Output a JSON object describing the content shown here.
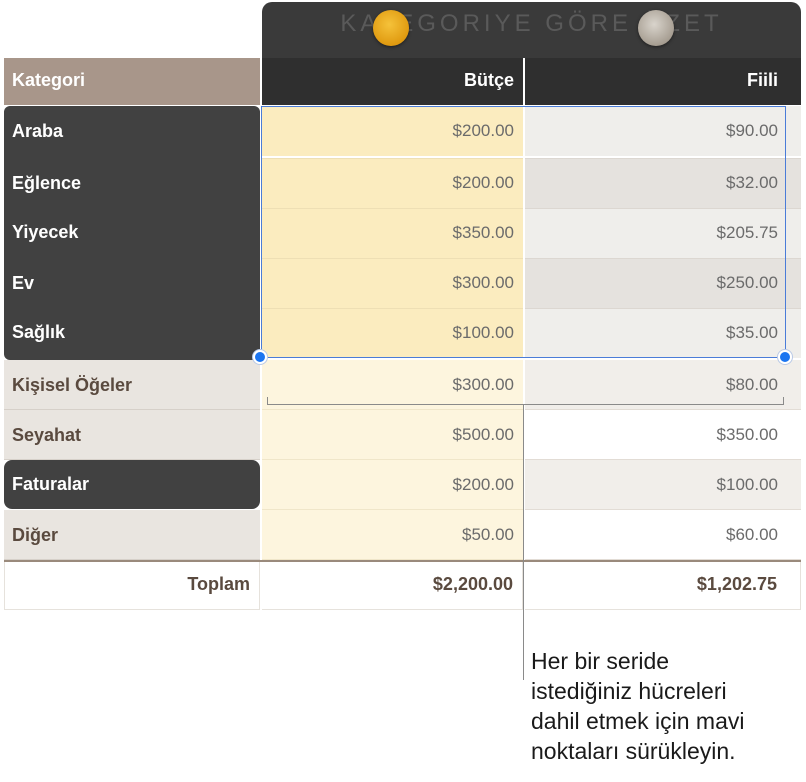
{
  "chart_title": "KATEGORIYE GÖRE ÖZET",
  "headers": {
    "category": "Kategori",
    "budget": "Bütçe",
    "actual": "Fiili"
  },
  "rows": [
    {
      "category": "Araba",
      "budget": "$200.00",
      "actual": "$90.00"
    },
    {
      "category": "Eğlence",
      "budget": "$200.00",
      "actual": "$32.00"
    },
    {
      "category": "Yiyecek",
      "budget": "$350.00",
      "actual": "$205.75"
    },
    {
      "category": "Ev",
      "budget": "$300.00",
      "actual": "$250.00"
    },
    {
      "category": "Sağlık",
      "budget": "$100.00",
      "actual": "$35.00"
    },
    {
      "category": "Kişisel Öğeler",
      "budget": "$300.00",
      "actual": "$80.00"
    },
    {
      "category": "Seyahat",
      "budget": "$500.00",
      "actual": "$350.00"
    },
    {
      "category": "Faturalar",
      "budget": "$200.00",
      "actual": "$100.00"
    },
    {
      "category": "Diğer",
      "budget": "$50.00",
      "actual": "$60.00"
    }
  ],
  "footer": {
    "label": "Toplam",
    "budget_total": "$2,200.00",
    "actual_total": "$1,202.75"
  },
  "callout": {
    "line1": "Her bir seride",
    "line2": "istediğiniz hücreleri",
    "line3": "dahil etmek için mavi",
    "line4": "noktaları sürükleyin."
  },
  "colors": {
    "selection": "#4a7cd8",
    "handle": "#1a74f0",
    "series_budget": "#f0b428",
    "series_actual": "#b3a99c"
  }
}
